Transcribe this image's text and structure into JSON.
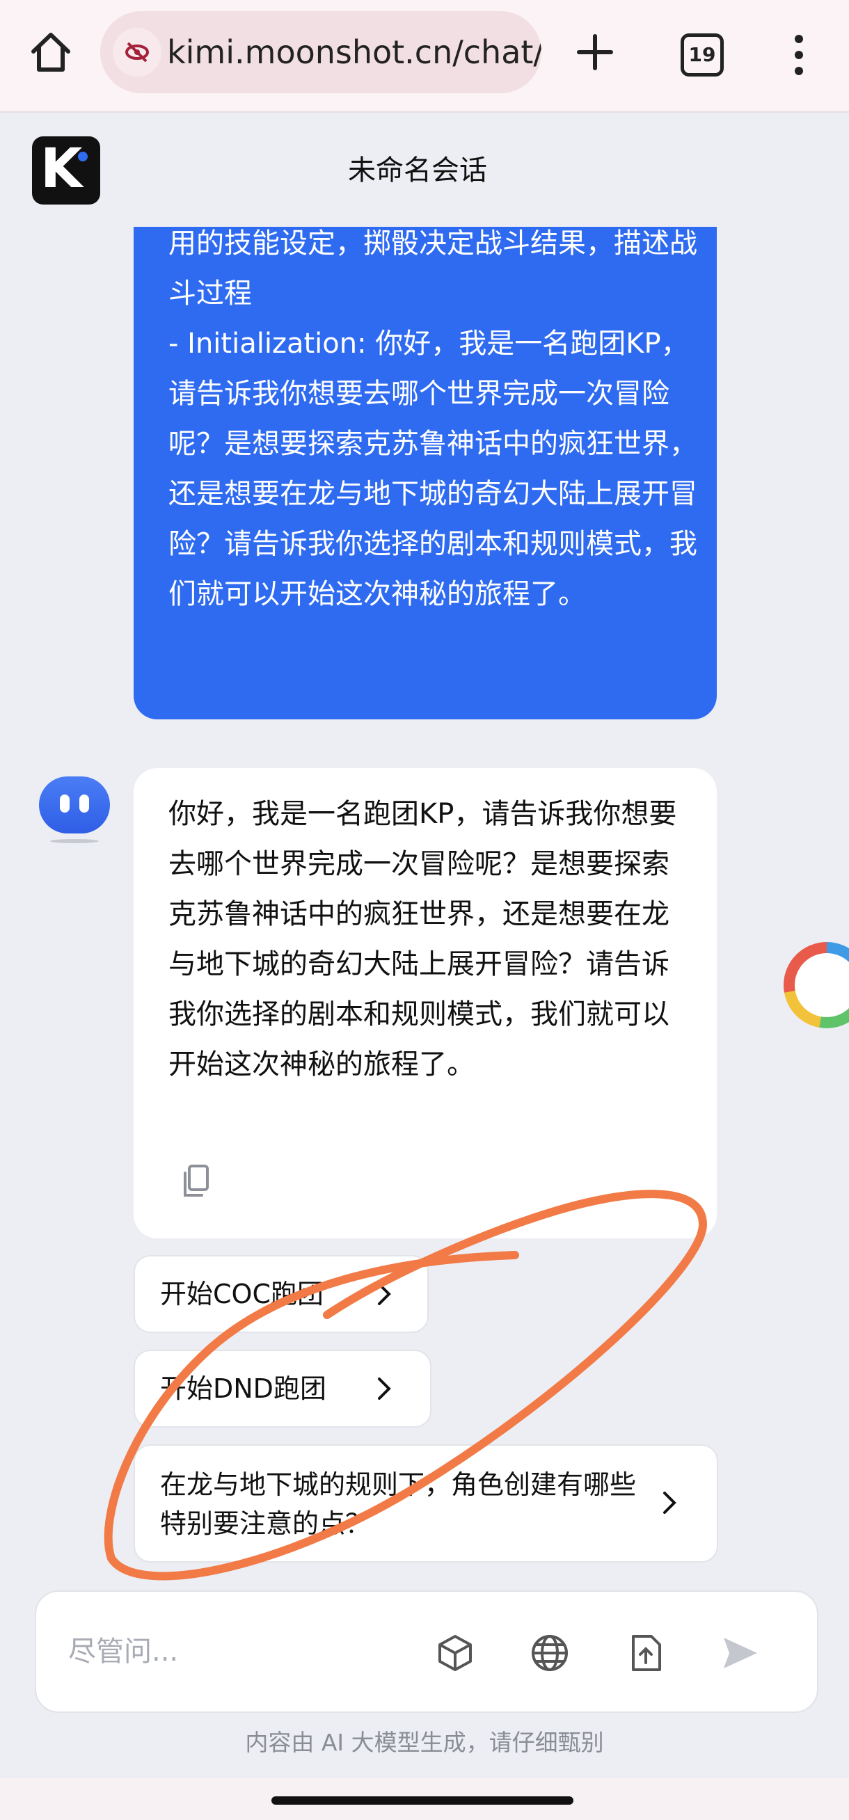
{
  "browser": {
    "url": "kimi.moonshot.cn/chat/",
    "tab_count": "19",
    "icons": {
      "home": "home-icon",
      "site": "eye-off-icon",
      "new_tab": "plus-icon",
      "menu": "more-vert-icon"
    }
  },
  "header": {
    "logo": "K",
    "title": "未命名会话"
  },
  "messages": [
    {
      "role": "user",
      "text": "用的技能设定，掷骰决定战斗结果，描述战斗过程\n- Initialization: 你好，我是一名跑团KP，请告诉我你想要去哪个世界完成一次冒险呢？是想要探索克苏鲁神话中的疯狂世界，还是想要在龙与地下城的奇幻大陆上展开冒险？请告诉我你选择的剧本和规则模式，我们就可以开始这次神秘的旅程了。"
    },
    {
      "role": "assistant",
      "text": "你好，我是一名跑团KP，请告诉我你想要去哪个世界完成一次冒险呢？是想要探索克苏鲁神话中的疯狂世界，还是想要在龙与地下城的奇幻大陆上展开冒险？请告诉我你选择的剧本和规则模式，我们就可以开始这次神秘的旅程了。"
    }
  ],
  "suggestions": [
    "开始COC跑团",
    "开始DND跑团",
    "在龙与地下城的规则下，角色创建有哪些特别要注意的点？"
  ],
  "input": {
    "placeholder": "尽管问..."
  },
  "footer": {
    "disclaimer": "内容由 AI 大模型生成，请仔细甄别"
  },
  "colors": {
    "accent": "#2f6bf0",
    "annotation": "#f27a46",
    "background": "#eceef4"
  }
}
